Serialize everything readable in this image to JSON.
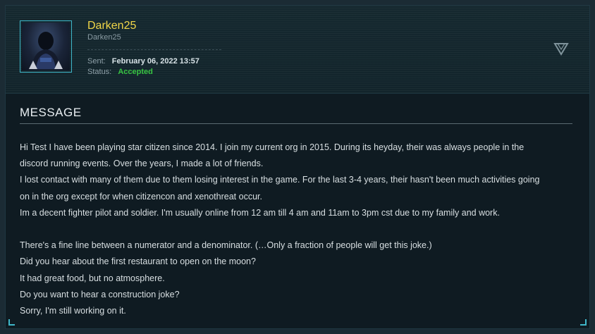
{
  "sender": {
    "display_name": "Darken25",
    "handle": "Darken25",
    "sent_label": "Sent:",
    "sent_value": "February 06, 2022 13:57",
    "status_label": "Status:",
    "status_value": "Accepted",
    "avatar_icon": "user-avatar-icon",
    "status_color": "#38c443",
    "name_color": "#f0d648"
  },
  "dropdown": {
    "icon": "chevron-down-triangle-icon"
  },
  "message": {
    "title": "MESSAGE",
    "lines": [
      "Hi Test I have been playing star citizen since 2014. I join my current org in 2015. During its heyday, their was always people in the",
      "discord running events. Over the years, I made a lot of friends.",
      "I lost contact with many of them due to them losing interest in the game. For the last 3-4 years, their hasn't been much activities going",
      "on in the org except for when citizencon and xenothreat occur.",
      "Im a decent fighter pilot and soldier. I'm usually online from 12 am till 4 am and 11am to 3pm cst due to my family and work.",
      "",
      "There's a fine line between a numerator and a denominator. (…Only a fraction of people will get this joke.)",
      "Did you hear about the first restaurant to open on the moon?",
      "It had great food, but no atmosphere.",
      "Do you want to hear a construction joke?",
      "Sorry, I'm still working on it."
    ]
  },
  "colors": {
    "accent": "#3fb7c9",
    "background": "#0f1b22"
  }
}
